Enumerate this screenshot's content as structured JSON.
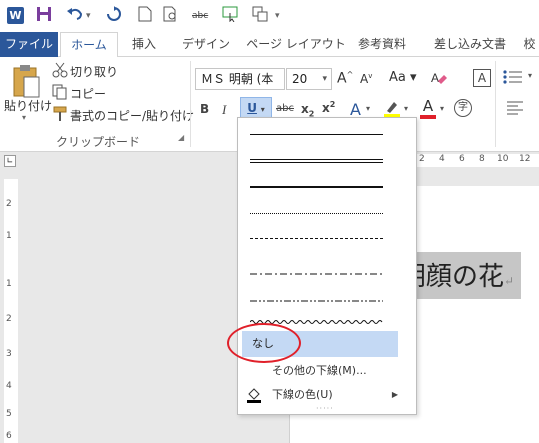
{
  "tabs": [
    {
      "label": "ファイル"
    },
    {
      "label": "ホーム"
    },
    {
      "label": "挿入"
    },
    {
      "label": "デザイン"
    },
    {
      "label": "ページ レイアウト"
    },
    {
      "label": "参考資料"
    },
    {
      "label": "差し込み文書"
    },
    {
      "label": "校"
    }
  ],
  "clipboard": {
    "paste": "貼り付け",
    "cut": "切り取り",
    "copy": "コピー",
    "format_painter": "書式のコピー/貼り付け",
    "group_label": "クリップボード"
  },
  "font": {
    "name": "ＭＳ 明朝 (本",
    "size": "20"
  },
  "ruler": {
    "h_marks": [
      "2",
      "4",
      "6",
      "8",
      "10",
      "12"
    ],
    "v_marks": [
      "2",
      "1",
      "1",
      "2",
      "3",
      "4",
      "5",
      "6"
    ]
  },
  "document": {
    "text": "朝顔の花"
  },
  "underline_menu": {
    "line_styles": [
      "single",
      "double",
      "thick",
      "dotted",
      "dashed",
      "dash-dot",
      "dash-dot-dot",
      "wave"
    ],
    "none_label": "なし",
    "more_label": "その他の下線(M)...",
    "color_label": "下線の色(U)"
  },
  "colors": {
    "brand": "#2b579a",
    "selection": "#c4d9f4",
    "highlight_circle": "#e0202a",
    "text_highlight": "#ffff00",
    "font_color": "#e0202a"
  }
}
